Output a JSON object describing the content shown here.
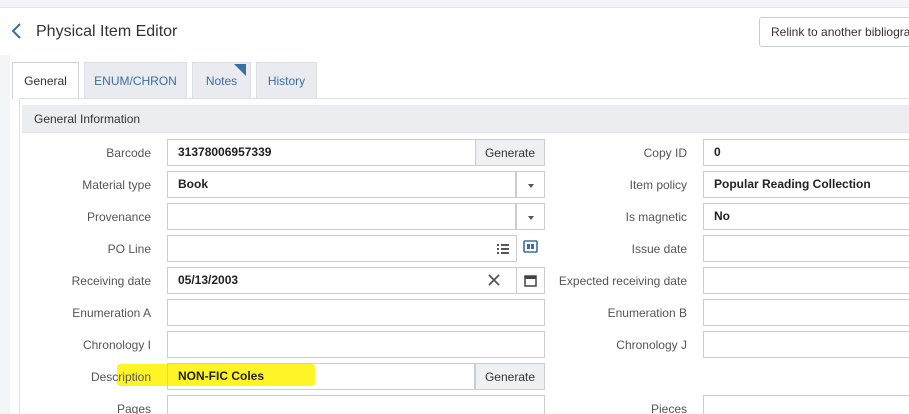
{
  "header": {
    "title": "Physical Item Editor",
    "relink_label": "Relink to another bibliograp"
  },
  "tabs": [
    {
      "label": "General"
    },
    {
      "label": "ENUM/CHRON"
    },
    {
      "label": "Notes"
    },
    {
      "label": "History"
    }
  ],
  "section": {
    "title": "General Information"
  },
  "generate_label": "Generate",
  "left": {
    "barcode": {
      "label": "Barcode",
      "value": "31378006957339"
    },
    "material_type": {
      "label": "Material type",
      "value": "Book"
    },
    "provenance": {
      "label": "Provenance",
      "value": ""
    },
    "po_line": {
      "label": "PO Line",
      "value": ""
    },
    "receiving_date": {
      "label": "Receiving date",
      "value": "05/13/2003"
    },
    "enumeration_a": {
      "label": "Enumeration A",
      "value": ""
    },
    "chronology_i": {
      "label": "Chronology I",
      "value": ""
    },
    "description": {
      "label": "Description",
      "value": "NON-FIC Coles"
    },
    "pages": {
      "label": "Pages",
      "value": ""
    }
  },
  "right": {
    "copy_id": {
      "label": "Copy ID",
      "value": "0"
    },
    "item_policy": {
      "label": "Item policy",
      "value": "Popular Reading Collection"
    },
    "is_magnetic": {
      "label": "Is magnetic",
      "value": "No"
    },
    "issue_date": {
      "label": "Issue date",
      "value": ""
    },
    "expected_receiving_date": {
      "label": "Expected receiving date",
      "value": ""
    },
    "enumeration_b": {
      "label": "Enumeration B",
      "value": ""
    },
    "chronology_j": {
      "label": "Chronology J",
      "value": ""
    },
    "pieces": {
      "label": "Pieces",
      "value": ""
    }
  },
  "colors": {
    "accent": "#3a6ea5",
    "highlight": "#fff200"
  }
}
